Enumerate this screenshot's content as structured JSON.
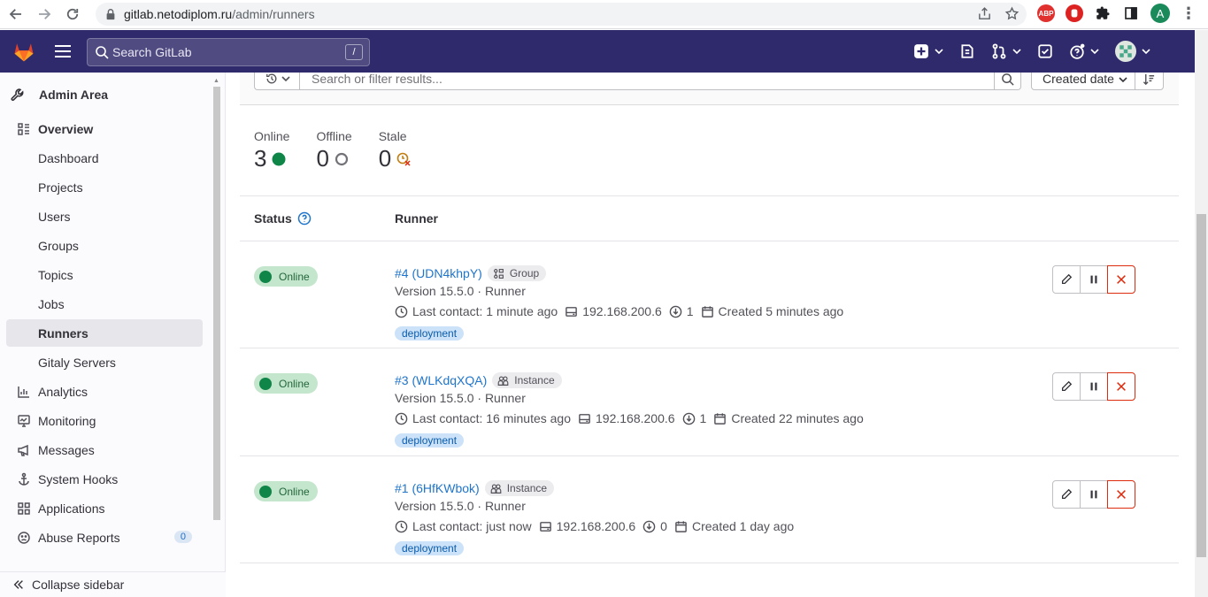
{
  "browser": {
    "url_host": "gitlab.netodiplom.ru",
    "url_path": "/admin/runners",
    "profile_initial": "A",
    "ext_abp": "ABP"
  },
  "topbar": {
    "search_placeholder": "Search GitLab",
    "search_shortcut": "/"
  },
  "sidebar": {
    "title": "Admin Area",
    "items": [
      {
        "label": "Overview",
        "icon": "overview-icon"
      },
      {
        "label": "Dashboard"
      },
      {
        "label": "Projects"
      },
      {
        "label": "Users"
      },
      {
        "label": "Groups"
      },
      {
        "label": "Topics"
      },
      {
        "label": "Jobs"
      },
      {
        "label": "Runners"
      },
      {
        "label": "Gitaly Servers"
      },
      {
        "label": "Analytics",
        "icon": "chart-icon"
      },
      {
        "label": "Monitoring",
        "icon": "monitor-icon"
      },
      {
        "label": "Messages",
        "icon": "bullhorn-icon"
      },
      {
        "label": "System Hooks",
        "icon": "anchor-icon"
      },
      {
        "label": "Applications",
        "icon": "applications-icon"
      },
      {
        "label": "Abuse Reports",
        "icon": "slight-frown-icon",
        "badge": "0"
      }
    ],
    "collapse_label": "Collapse sidebar"
  },
  "filter": {
    "placeholder": "Search or filter results...",
    "sort_label": "Created date"
  },
  "stats": [
    {
      "label": "Online",
      "value": "3",
      "icon": "status-online-icon",
      "color": "#108548"
    },
    {
      "label": "Offline",
      "value": "0",
      "icon": "status-offline-icon",
      "color": "#737278"
    },
    {
      "label": "Stale",
      "value": "0",
      "icon": "status-stale-icon",
      "color": "#c17d10"
    }
  ],
  "table": {
    "col_status": "Status",
    "col_runner": "Runner"
  },
  "runners": [
    {
      "status": "Online",
      "name": "#4 (UDN4khpY)",
      "type": "Group",
      "version": "Version 15.5.0 · Runner",
      "last_contact": "Last contact: 1 minute ago",
      "ip": "192.168.200.6",
      "jobs": "1",
      "created": "Created 5 minutes ago",
      "tag": "deployment"
    },
    {
      "status": "Online",
      "name": "#3 (WLKdqXQA)",
      "type": "Instance",
      "version": "Version 15.5.0 · Runner",
      "last_contact": "Last contact: 16 minutes ago",
      "ip": "192.168.200.6",
      "jobs": "1",
      "created": "Created 22 minutes ago",
      "tag": "deployment"
    },
    {
      "status": "Online",
      "name": "#1 (6HfKWbok)",
      "type": "Instance",
      "version": "Version 15.5.0 · Runner",
      "last_contact": "Last contact: just now",
      "ip": "192.168.200.6",
      "jobs": "0",
      "created": "Created 1 day ago",
      "tag": "deployment"
    }
  ],
  "colors": {
    "topbar": "#2f2a6b",
    "online": "#108548",
    "link": "#1f75cb",
    "danger": "#dd2b0e"
  }
}
